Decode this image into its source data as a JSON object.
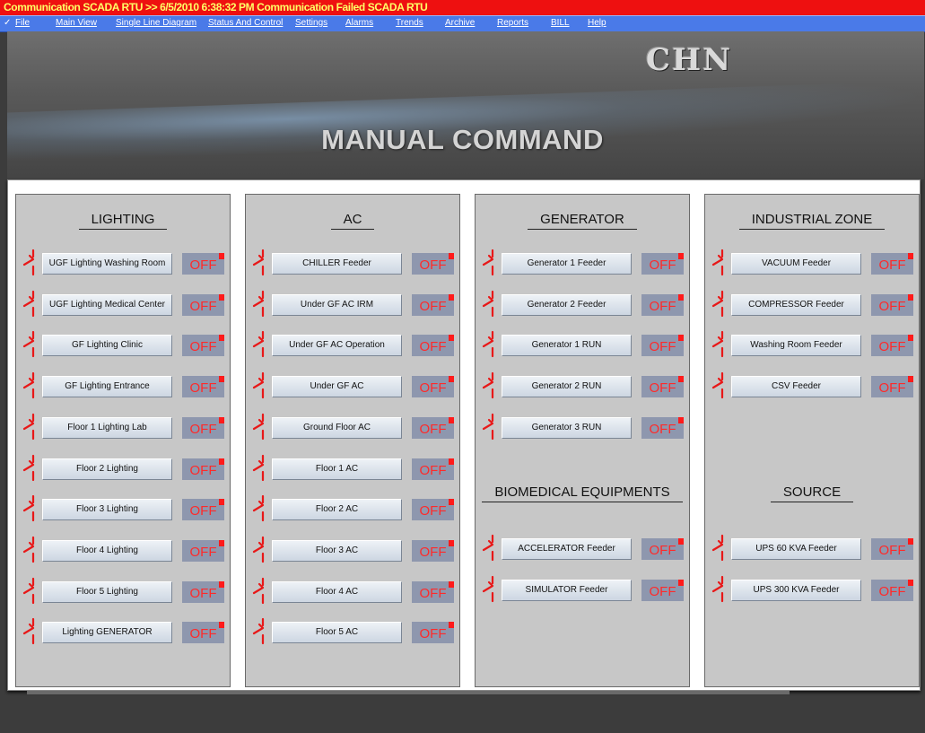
{
  "window": {
    "title": "Communication SCADA RTU >> 6/5/2010 6:38:32 PM   Communication Failed SCADA RTU"
  },
  "menu": {
    "items": [
      "File",
      "Main View",
      "Single Line Diagram",
      "Status And Control",
      "Settings",
      "Alarms",
      "Trends",
      "Archive",
      "Reports",
      "BILL",
      "Help"
    ]
  },
  "header": {
    "logo": "CHN",
    "page_title": "MANUAL COMMAND"
  },
  "colors": {
    "title_bar": "#ee1010",
    "title_text": "#ffff66",
    "menu_bar": "#4a7ae8",
    "status_bg": "#8e97ae",
    "status_text": "#ff2a2a",
    "switch_icon": "#e81818"
  },
  "icons": {
    "switch": "open-breaker-switch-icon",
    "status_marker": "red-square-indicator"
  },
  "panels": {
    "lighting": {
      "title": "LIGHTING",
      "items": [
        {
          "label": "UGF Lighting Washing Room",
          "status": "OFF"
        },
        {
          "label": "UGF Lighting Medical Center",
          "status": "OFF"
        },
        {
          "label": "GF Lighting Clinic",
          "status": "OFF"
        },
        {
          "label": "GF Lighting Entrance",
          "status": "OFF"
        },
        {
          "label": "Floor 1 Lighting Lab",
          "status": "OFF"
        },
        {
          "label": "Floor 2 Lighting",
          "status": "OFF"
        },
        {
          "label": "Floor 3 Lighting",
          "status": "OFF"
        },
        {
          "label": "Floor 4 Lighting",
          "status": "OFF"
        },
        {
          "label": "Floor 5 Lighting",
          "status": "OFF"
        },
        {
          "label": "Lighting GENERATOR",
          "status": "OFF"
        }
      ]
    },
    "ac": {
      "title": "AC",
      "items": [
        {
          "label": "CHILLER Feeder",
          "status": "OFF"
        },
        {
          "label": "Under GF AC IRM",
          "status": "OFF"
        },
        {
          "label": "Under GF AC Operation",
          "status": "OFF"
        },
        {
          "label": "Under GF AC",
          "status": "OFF"
        },
        {
          "label": "Ground Floor AC",
          "status": "OFF"
        },
        {
          "label": "Floor 1 AC",
          "status": "OFF"
        },
        {
          "label": "Floor 2 AC",
          "status": "OFF"
        },
        {
          "label": "Floor 3 AC",
          "status": "OFF"
        },
        {
          "label": "Floor 4 AC",
          "status": "OFF"
        },
        {
          "label": "Floor 5 AC",
          "status": "OFF"
        }
      ]
    },
    "generator": {
      "title": "GENERATOR",
      "items": [
        {
          "label": "Generator 1 Feeder",
          "status": "OFF"
        },
        {
          "label": "Generator 2 Feeder",
          "status": "OFF"
        },
        {
          "label": "Generator 1 RUN",
          "status": "OFF"
        },
        {
          "label": "Generator 2 RUN",
          "status": "OFF"
        },
        {
          "label": "Generator 3 RUN",
          "status": "OFF"
        }
      ]
    },
    "biomedical": {
      "title": "BIOMEDICAL EQUIPMENTS",
      "items": [
        {
          "label": "ACCELERATOR Feeder",
          "status": "OFF"
        },
        {
          "label": "SIMULATOR Feeder",
          "status": "OFF"
        }
      ]
    },
    "industrial": {
      "title": "INDUSTRIAL ZONE",
      "items": [
        {
          "label": "VACUUM Feeder",
          "status": "OFF"
        },
        {
          "label": "COMPRESSOR Feeder",
          "status": "OFF"
        },
        {
          "label": "Washing Room Feeder",
          "status": "OFF"
        },
        {
          "label": "CSV  Feeder",
          "status": "OFF"
        }
      ]
    },
    "source": {
      "title": "SOURCE",
      "items": [
        {
          "label": "UPS 60 KVA Feeder",
          "status": "OFF"
        },
        {
          "label": "UPS 300 KVA Feeder",
          "status": "OFF"
        }
      ]
    }
  }
}
